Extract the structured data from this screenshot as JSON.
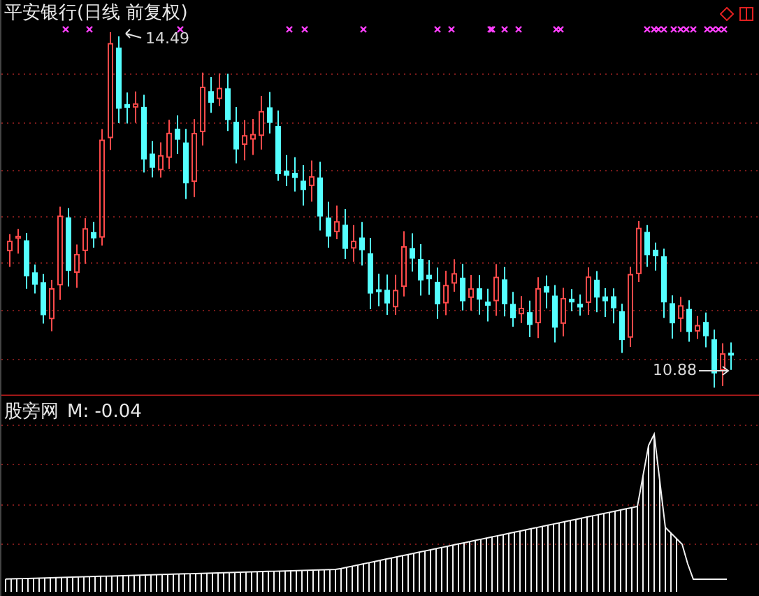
{
  "price_panel": {
    "title": "平安银行(日线 前复权)",
    "high_label": "14.49",
    "low_label": "10.88"
  },
  "indicator_panel": {
    "name": "股旁网",
    "reading": "M: -0.04"
  }
}
